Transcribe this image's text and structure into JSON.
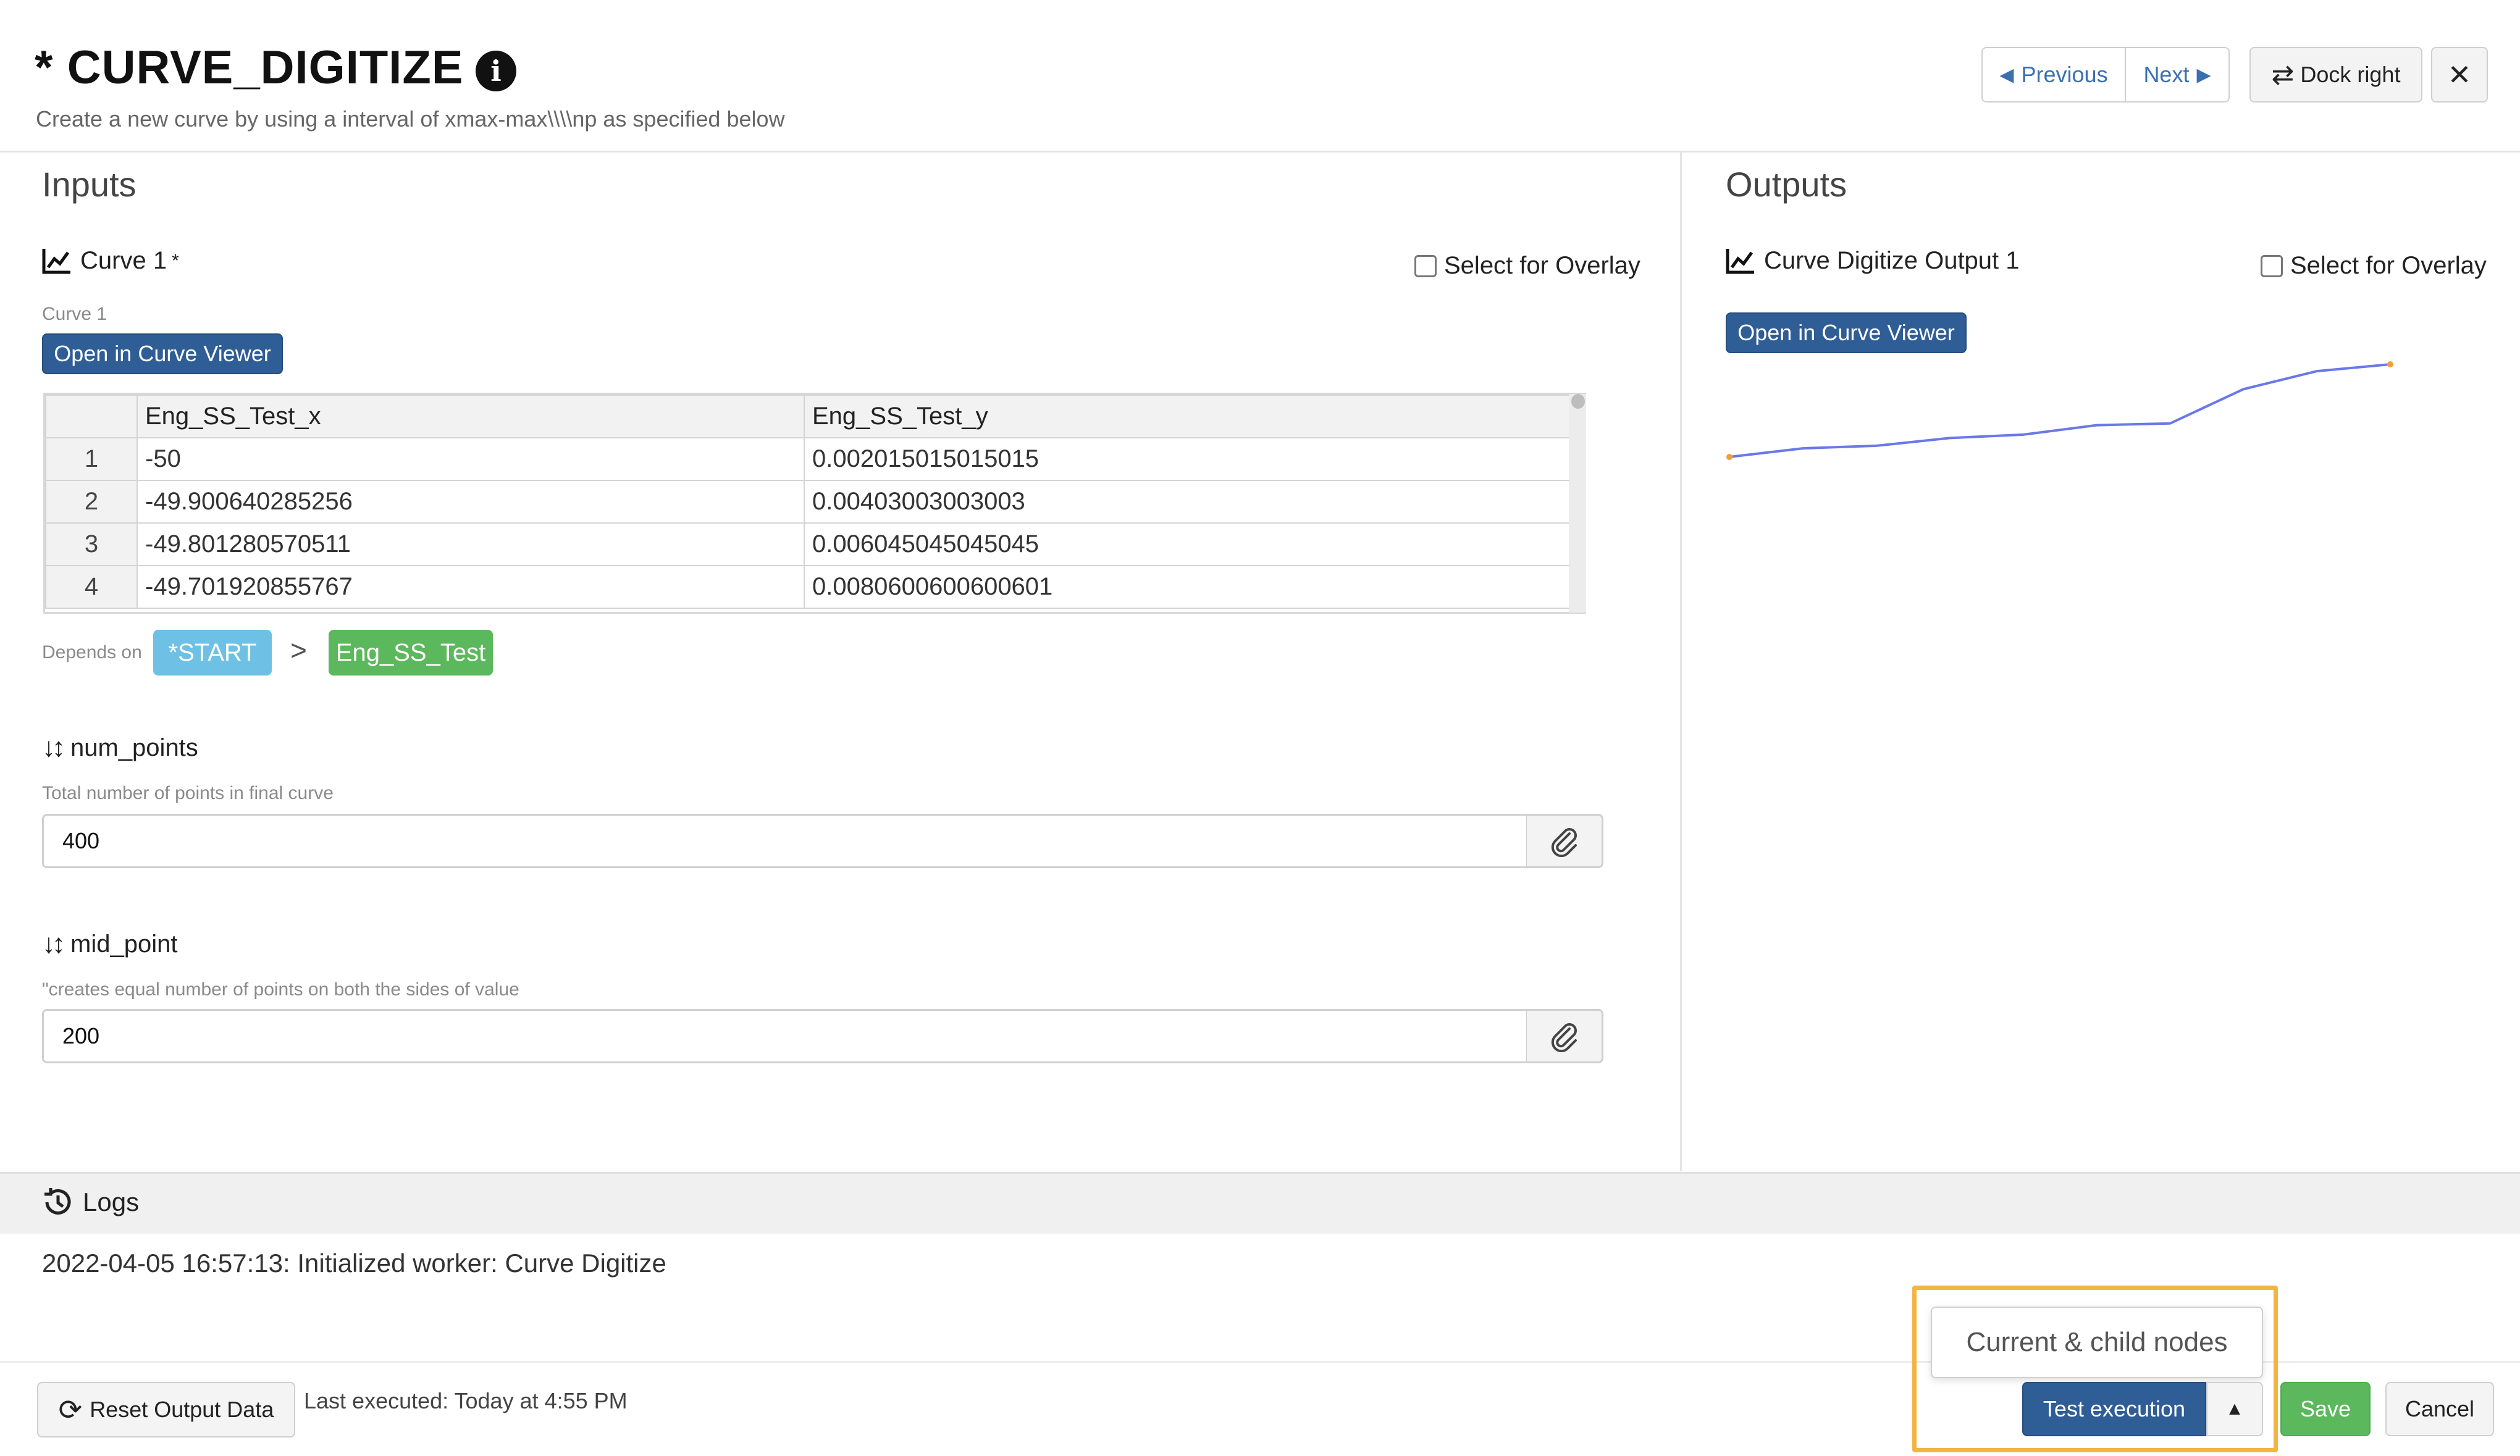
{
  "header": {
    "title": "* CURVE_DIGITIZE",
    "subtitle": "Create a new curve by using a interval of xmax-max\\\\\\\\np as specified below",
    "previous_label": "Previous",
    "next_label": "Next",
    "dock_label": "Dock right",
    "close_label": "✕"
  },
  "inputs": {
    "title": "Inputs",
    "curve": {
      "label": "Curve 1",
      "required_mark": "*",
      "hint": "Curve 1",
      "overlay_label": "Select for Overlay",
      "open_viewer_label": "Open in Curve Viewer",
      "columns": [
        "",
        "Eng_SS_Test_x",
        "Eng_SS_Test_y"
      ],
      "rows": [
        [
          "1",
          "-50",
          "0.002015015015015"
        ],
        [
          "2",
          "-49.900640285256",
          "0.00403003003003"
        ],
        [
          "3",
          "-49.801280570511",
          "0.006045045045045"
        ],
        [
          "4",
          "-49.701920855767",
          "0.0080600600600601"
        ]
      ],
      "depends_label": "Depends on",
      "dep_start": "*START",
      "dep_chevron": ">",
      "dep_eng": "Eng_SS_Test"
    },
    "num_points": {
      "label": "num_points",
      "hint": "Total number of points in final curve",
      "value": "400"
    },
    "mid_point": {
      "label": "mid_point",
      "hint": "\"creates equal number of points on both the sides of value",
      "value": "200"
    }
  },
  "outputs": {
    "title": "Outputs",
    "label": "Curve Digitize Output 1",
    "overlay_label": "Select for Overlay",
    "open_viewer_label": "Open in Curve Viewer"
  },
  "chart_data": {
    "type": "line",
    "x": [
      0,
      1,
      2,
      3,
      4,
      5,
      6,
      7,
      8,
      9
    ],
    "y": [
      0.0,
      0.1,
      0.13,
      0.22,
      0.26,
      0.37,
      0.39,
      0.79,
      1.0,
      1.08
    ],
    "series_color": "#6a78e8",
    "endpoint_color": "#f39c3c",
    "grid": false
  },
  "logs": {
    "title": "Logs",
    "line": "2022-04-05 16:57:13:  Initialized worker: Curve Digitize"
  },
  "footer": {
    "reset_label": "Reset Output Data",
    "last_executed": "Last executed: Today at 4:55 PM",
    "dropdown_item": "Current & child nodes",
    "test_label": "Test execution",
    "save_label": "Save",
    "cancel_label": "Cancel"
  },
  "colors": {
    "primary": "#2f5d95",
    "start_tag": "#6ec1e4",
    "eng_tag": "#5cb85c",
    "save": "#5cb85c",
    "highlight": "#f3b443"
  }
}
